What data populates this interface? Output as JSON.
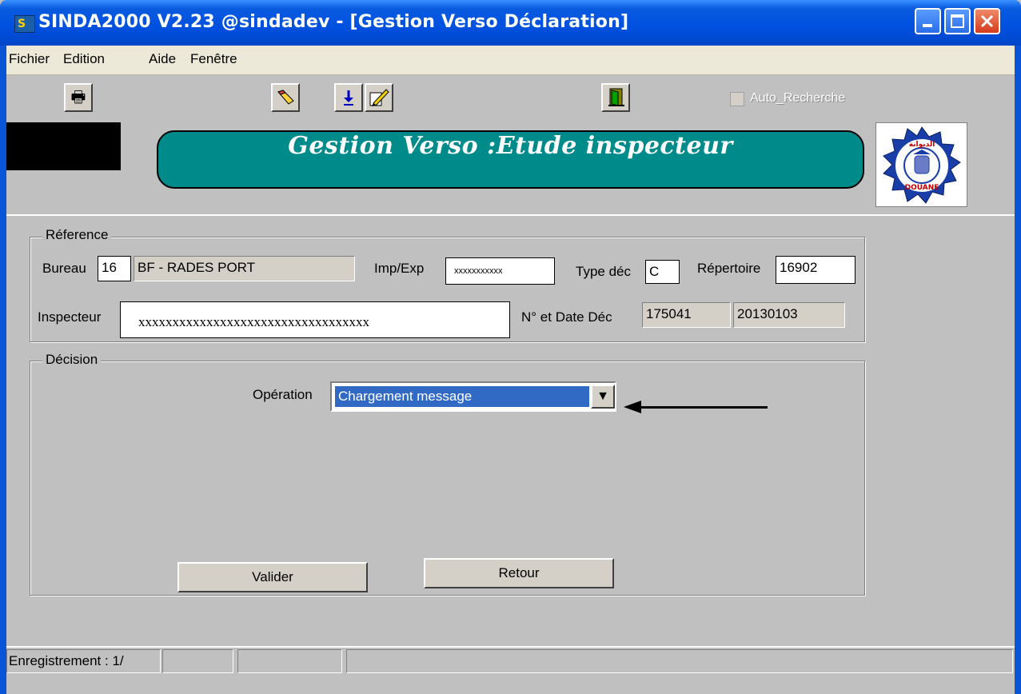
{
  "window": {
    "title": "SINDA2000 V2.23 @sindadev - [Gestion Verso Déclaration]",
    "app_icon": "sinda-app-icon"
  },
  "menu": [
    "Fichier",
    "Edition",
    "Aide",
    "Fenêtre"
  ],
  "toolbar": {
    "buttons": [
      "printer-icon",
      "eraser-icon",
      "download-arrow-icon",
      "pencil-edit-icon",
      "exit-door-icon"
    ],
    "auto_recherche": {
      "label": "Auto_Recherche",
      "checked": false,
      "enabled": false
    }
  },
  "banner": {
    "title": "Gestion Verso :Etude inspecteur"
  },
  "logo": {
    "text_top": "ﺍﻟﺪﻳﻮﺍﻧﺔ",
    "text_bottom": "DOUANE"
  },
  "reference": {
    "legend": "Réference",
    "bureau_label": "Bureau",
    "bureau_code": "16",
    "bureau_name": "BF - RADES PORT",
    "impexp_label": "Imp/Exp",
    "impexp_value": "xxxxxxxxxxx",
    "type_dec_label": "Type déc",
    "type_dec_value": "C",
    "repertoire_label": "Répertoire",
    "repertoire_value": "16902",
    "inspecteur_label": "Inspecteur",
    "inspecteur_value": "xxxxxxxxxxxxxxxxxxxxxxxxxxxxxxxxxx",
    "num_date_label": "N° et Date Déc",
    "num_dec": "175041",
    "date_dec": "20130103"
  },
  "decision": {
    "legend": "Décision",
    "operation_label": "Opération",
    "operation_selected": "Chargement message",
    "valider_label": "Valider",
    "retour_label": "Retour"
  },
  "statusbar": [
    "Enregistrement : 1/",
    "",
    "",
    ""
  ],
  "colors": {
    "banner": "#008b8b",
    "title_bar": "#0050e0",
    "selection": "#316ac5",
    "window_bg": "#c0c0c0"
  }
}
